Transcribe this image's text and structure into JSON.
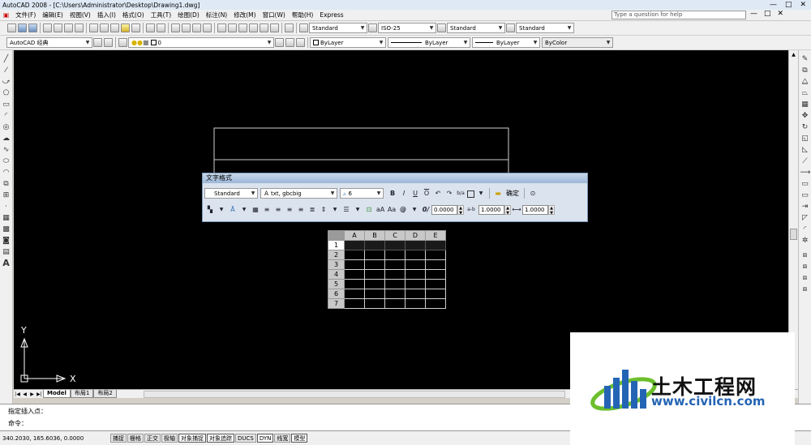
{
  "window": {
    "title": "AutoCAD 2008 - [C:\\Users\\Administrator\\Desktop\\Drawing1.dwg]",
    "controls": [
      "—",
      "□",
      "✕"
    ]
  },
  "menu": {
    "items": [
      "文件(F)",
      "编辑(E)",
      "视图(V)",
      "插入(I)",
      "格式(O)",
      "工具(T)",
      "绘图(D)",
      "标注(N)",
      "修改(M)",
      "窗口(W)",
      "帮助(H)",
      "Express"
    ],
    "help_placeholder": "Type a question for help",
    "doc_controls": [
      "—",
      "□",
      "✕"
    ]
  },
  "toolbar1": {
    "text_style": "Standard",
    "dim_style": "ISO-25",
    "table_style": "Standard",
    "multileader_style": "Standard"
  },
  "toolbar2": {
    "workspace": "AutoCAD 经典",
    "layer": "0",
    "color": "ByLayer",
    "linetype": "ByLayer",
    "lineweight": "ByLayer",
    "plotstyle": "ByColor"
  },
  "text_formatting": {
    "title": "文字格式",
    "style": "Standard",
    "font": "txt, gbcbig",
    "height": "6",
    "ok_label": "确定",
    "oblique": "0.0000",
    "tracking": "1.0000",
    "width_factor": "1.0000",
    "bold": "B",
    "italic": "I",
    "underline": "U",
    "overline": "O",
    "undo": "↶",
    "redo": "↷",
    "stack": "b/a",
    "upper": "aA",
    "lower": "Aa",
    "symbol": "@",
    "oblique_icon": "0/",
    "tracking_icon": "a-b",
    "width_icon": "⟷",
    "options": "⊙"
  },
  "table": {
    "columns": [
      "A",
      "B",
      "C",
      "D",
      "E"
    ],
    "rows": [
      "1",
      "2",
      "3",
      "4",
      "5",
      "6",
      "7"
    ]
  },
  "ucs": {
    "x_label": "X",
    "y_label": "Y"
  },
  "tabs": {
    "items": [
      "Model",
      "布局1",
      "布局2"
    ]
  },
  "command": {
    "line1": "指定插入点：",
    "line2": "命令："
  },
  "status": {
    "coords": "340.2030, 165.6036, 0.0000",
    "buttons": [
      "捕捉",
      "栅格",
      "正交",
      "极轴",
      "对象捕捉",
      "对象追踪",
      "DUCS",
      "DYN",
      "线宽",
      "模型"
    ]
  },
  "watermark": {
    "cn": "土木工程网",
    "url": "www.civilcn.com"
  },
  "colors": {
    "canvas": "#000000",
    "chrome": "#f0f0f0",
    "panel": "#dbe3ee",
    "logo_blue": "#2464b4",
    "logo_green": "#6cbf2c"
  }
}
